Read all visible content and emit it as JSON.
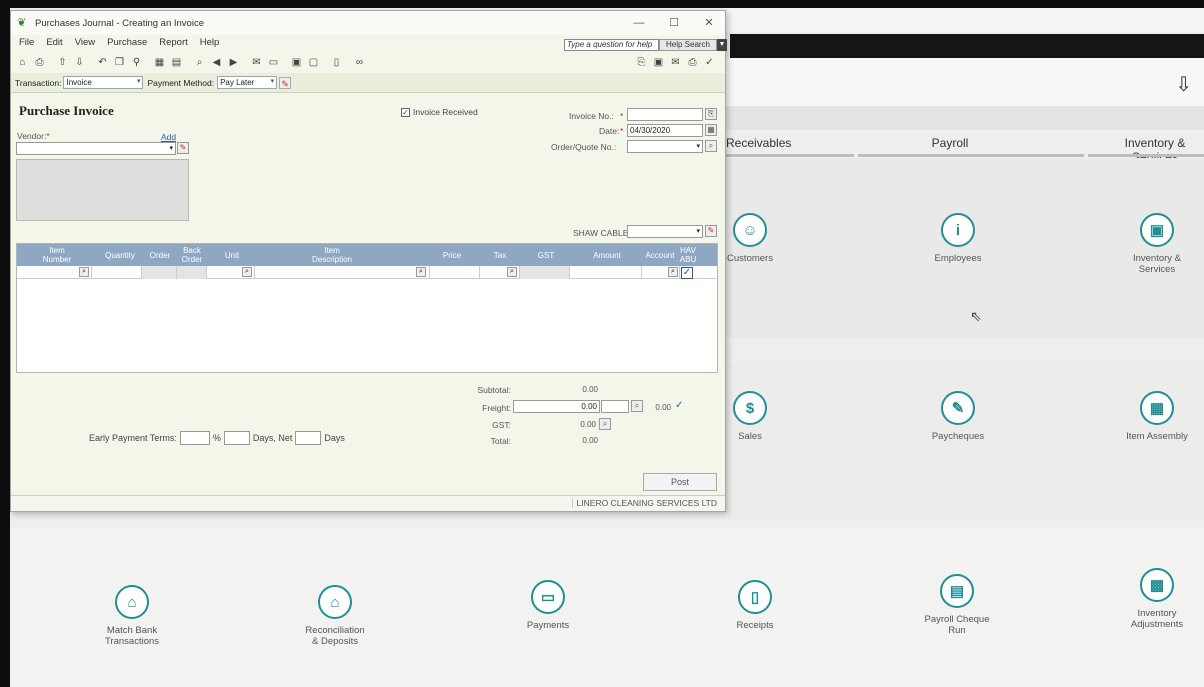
{
  "window": {
    "title": "Purchases Journal - Creating an Invoice",
    "min": "—",
    "max": "☐",
    "close": "✕"
  },
  "menu": [
    "File",
    "Edit",
    "View",
    "Purchase",
    "Report",
    "Help"
  ],
  "help": {
    "placeholder": "Type a question for help",
    "button": "Help Search"
  },
  "transaction": {
    "label": "Transaction:",
    "value": "Invoice",
    "payment_label": "Payment Method:",
    "payment_value": "Pay Later"
  },
  "form": {
    "title": "Purchase Invoice",
    "invoice_received": "Invoice Received",
    "vendor_label": "Vendor:",
    "vendor_required": "*",
    "add_link": "Add",
    "invoice_no_label": "Invoice No.:",
    "date_label": "Date:",
    "date_value": "04/30/2020",
    "order_quote_label": "Order/Quote No.:",
    "shaw_label": "SHAW CABLE:"
  },
  "grid": {
    "headers": [
      "Item\nNumber",
      "Quantity",
      "Order",
      "Back\nOrder",
      "Unit",
      "Item\nDescription",
      "Price",
      "Tax",
      "GST",
      "Amount",
      "Account",
      "HAV\nABU"
    ]
  },
  "totals": {
    "subtotal_label": "Subtotal:",
    "subtotal_value": "0.00",
    "freight_label": "Freight:",
    "freight_value": "0.00",
    "freight_tax": "0.00",
    "gst_label": "GST:",
    "gst_value": "0.00",
    "total_label": "Total:",
    "total_value": "0.00"
  },
  "early_terms": {
    "label": "Early Payment Terms:",
    "pct": "%",
    "days_net": "Days, Net",
    "days": "Days"
  },
  "post": "Post",
  "company": "LINERO CLEANING SERVICES LTD",
  "background": {
    "tabs": [
      "Receivables",
      "Payroll",
      "Inventory & Services"
    ],
    "tiles": [
      {
        "label": "Customers",
        "glyph": "☺"
      },
      {
        "label": "Employees",
        "glyph": "i"
      },
      {
        "label": "Inventory &\nServices",
        "glyph": "▣"
      },
      {
        "label": "Sales",
        "glyph": "$"
      },
      {
        "label": "Paycheques",
        "glyph": "✎"
      },
      {
        "label": "Item Assembly",
        "glyph": "▦"
      },
      {
        "label": "Match Bank\nTransactions",
        "glyph": "⌂"
      },
      {
        "label": "Reconciliation\n& Deposits",
        "glyph": "⌂"
      },
      {
        "label": "Payments",
        "glyph": "▭"
      },
      {
        "label": "Receipts",
        "glyph": "▯"
      },
      {
        "label": "Payroll Cheque\nRun",
        "glyph": "▤"
      },
      {
        "label": "Inventory\nAdjustments",
        "glyph": "▩"
      }
    ]
  }
}
